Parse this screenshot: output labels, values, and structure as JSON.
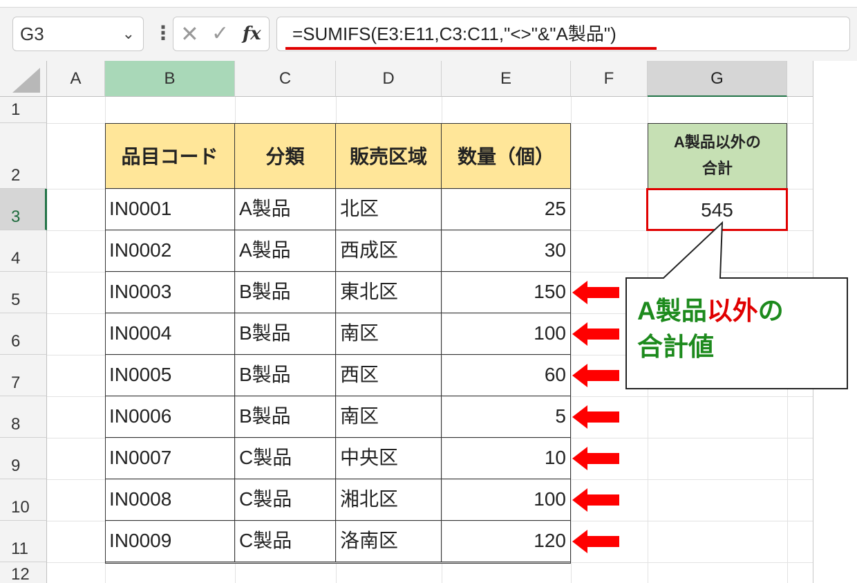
{
  "formula_bar": {
    "name_box": "G3",
    "formula": "=SUMIFS(E3:E11,C3:C11,\"<>\"&\"A製品\")",
    "icons": [
      "chevron-down-icon",
      "more-options-icon",
      "cancel-icon",
      "enter-icon",
      "fx-icon"
    ],
    "underline_color": "#e00000"
  },
  "columns": [
    "A",
    "B",
    "C",
    "D",
    "E",
    "F",
    "G"
  ],
  "rows": [
    "1",
    "2",
    "3",
    "4",
    "5",
    "6",
    "7",
    "8",
    "9",
    "10",
    "11",
    "12"
  ],
  "table": {
    "headers": [
      "品目コード",
      "分類",
      "販売区域",
      "数量（個）"
    ],
    "rows": [
      {
        "code": "IN0001",
        "category": "A製品",
        "area": "北区",
        "qty": "25"
      },
      {
        "code": "IN0002",
        "category": "A製品",
        "area": "西成区",
        "qty": "30"
      },
      {
        "code": "IN0003",
        "category": "B製品",
        "area": "東北区",
        "qty": "150"
      },
      {
        "code": "IN0004",
        "category": "B製品",
        "area": "南区",
        "qty": "100"
      },
      {
        "code": "IN0005",
        "category": "B製品",
        "area": "西区",
        "qty": "60"
      },
      {
        "code": "IN0006",
        "category": "B製品",
        "area": "南区",
        "qty": "5"
      },
      {
        "code": "IN0007",
        "category": "C製品",
        "area": "中央区",
        "qty": "10"
      },
      {
        "code": "IN0008",
        "category": "C製品",
        "area": "湘北区",
        "qty": "100"
      },
      {
        "code": "IN0009",
        "category": "C製品",
        "area": "洛南区",
        "qty": "120"
      }
    ],
    "header_color": "#ffe699"
  },
  "result": {
    "label_line1": "A製品以外の",
    "label_line2": "合計",
    "value": "545",
    "label_color": "#c6e0b4",
    "highlight_color": "#e00000"
  },
  "callout": {
    "part1": "A製品",
    "part2": "以外",
    "part3": "の",
    "line2": "合計値",
    "green": "#1d8a1d",
    "red": "#e00000"
  },
  "arrow_rows": [
    "5",
    "6",
    "7",
    "8",
    "9",
    "10",
    "11"
  ]
}
